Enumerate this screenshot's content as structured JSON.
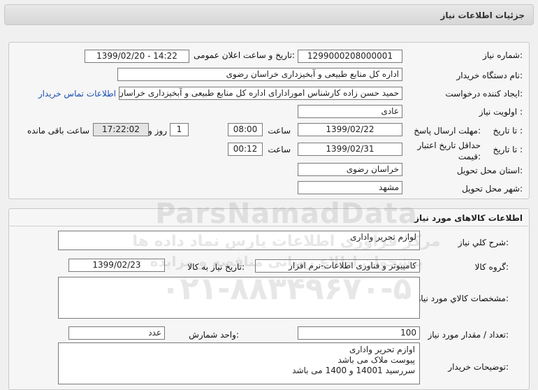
{
  "header": {
    "title": "جزئیات اطلاعات نیاز"
  },
  "details": {
    "need_number_label": "شماره نیاز:",
    "need_number": "1299000208000001",
    "announce_label": "تاریخ و ساعت اعلان عمومی:",
    "announce_value": "1399/02/20 - 14:22",
    "buyer_org_label": "نام دستگاه خریدار:",
    "buyer_org": "اداره کل منابع طبیعی و آبخیزداری خراسان رضوی",
    "creator_label": "ایجاد کننده درخواست:",
    "creator": "حمید حسن زاده  کارشناس امورادارای اداره کل منابع طبیعی و آبخیزداری خراسان",
    "contact_link": "اطلاعات تماس خریدار",
    "priority_label": "اولویت نیاز :",
    "priority": "عادی",
    "deadline_label": "مهلت ارسال پاسخ:",
    "until_date_label": "تا تاریخ :",
    "deadline_date": "1399/02/22",
    "time_label": "ساعت",
    "deadline_time": "08:00",
    "days": "1",
    "days_label": "روز و",
    "remaining": "17:22:02",
    "remaining_label": "ساعت باقی مانده",
    "validity_label": "حداقل تاریخ اعتبار قیمت:",
    "validity_date": "1399/02/31",
    "validity_time": "00:12",
    "province_label": "استان محل تحویل:",
    "province": "خراسان رضوی",
    "city_label": "شهر محل تحویل:",
    "city": "مشهد"
  },
  "goods": {
    "title": "اطلاعات کالاهای مورد نیاز",
    "desc_label": "شرح کلي نياز:",
    "desc": "لوازم تحریر واداری",
    "group_label": "گروه کالا:",
    "group": "کامپیوتر و فناوری اطلاعات-نرم افزار",
    "need_date_label": "تاریخ نیاز به کالا:",
    "need_date": "1399/02/23",
    "specs_label": "مشخصات کالاي مورد نياز:",
    "specs": "",
    "qty_label": "تعداد / مقدار مورد نیاز:",
    "qty": "100",
    "unit_label": "واحد شمارش:",
    "unit": "عدد",
    "buyer_notes_label": "توضیحات خریدار:",
    "buyer_notes": [
      "اوازم تحریر واداری",
      "پیوست ملاک می باشد",
      "سررسید 14001 و 1400 می باشد"
    ]
  },
  "watermark": {
    "brand": "ParsNamadData",
    "line1": "مرکز فرآوری اطلاعات پارس نماد داده ها",
    "line2": "پیشخوان اطلاع رسانی مناقصه و مزایده",
    "phone": "۰۲۱-۸۸۳۴۹۶۷۰-۵"
  }
}
